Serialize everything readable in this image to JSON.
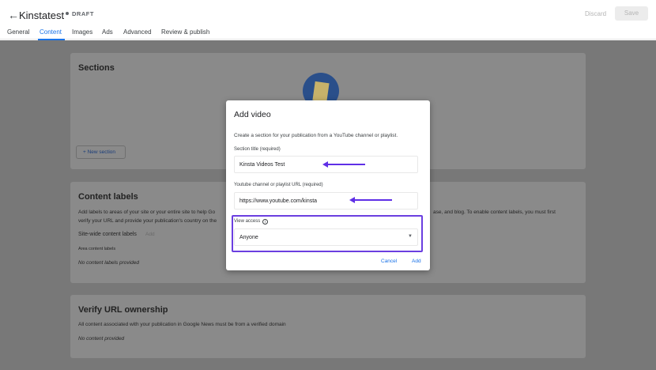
{
  "header": {
    "back_icon": "arrow-left-icon",
    "title": "Kinstatest",
    "status": "DRAFT",
    "discard_label": "Discard",
    "save_label": "Save"
  },
  "tabs": [
    {
      "label": "General"
    },
    {
      "label": "Content",
      "active": true
    },
    {
      "label": "Images"
    },
    {
      "label": "Ads"
    },
    {
      "label": "Advanced"
    },
    {
      "label": "Review & publish"
    }
  ],
  "sections_card": {
    "title": "Sections",
    "new_section_label": "+ New section"
  },
  "content_labels_card": {
    "title": "Content labels",
    "line1_left": "Add labels to areas of your site or your entire site to help Go",
    "line1_right": "ase, and blog. To enable content labels, you must first",
    "line2": "verify your URL and provide your publication's country on the",
    "site_wide_label": "Site-wide content labels",
    "site_wide_add": "Add",
    "area_label": "Area content labels",
    "empty_text": "No content labels provided"
  },
  "verify_card": {
    "title": "Verify URL ownership",
    "description": "All content associated with your publication in Google News must be from a verified domain",
    "empty_text": "No content provided"
  },
  "modal": {
    "title": "Add video",
    "description": "Create a section for your publication from a YouTube channel or playlist.",
    "section_title_label": "Section title (required)",
    "section_title_value": "Kinsta Videos Test",
    "url_label": "Youtube channel or playlist URL (required)",
    "url_value": "https://www.youtube.com/kinsta",
    "view_access_label": "View access",
    "view_access_value": "Anyone",
    "cancel_label": "Cancel",
    "add_label": "Add"
  },
  "colors": {
    "accent": "#1a73e8",
    "annotation": "#5f2fe6"
  }
}
